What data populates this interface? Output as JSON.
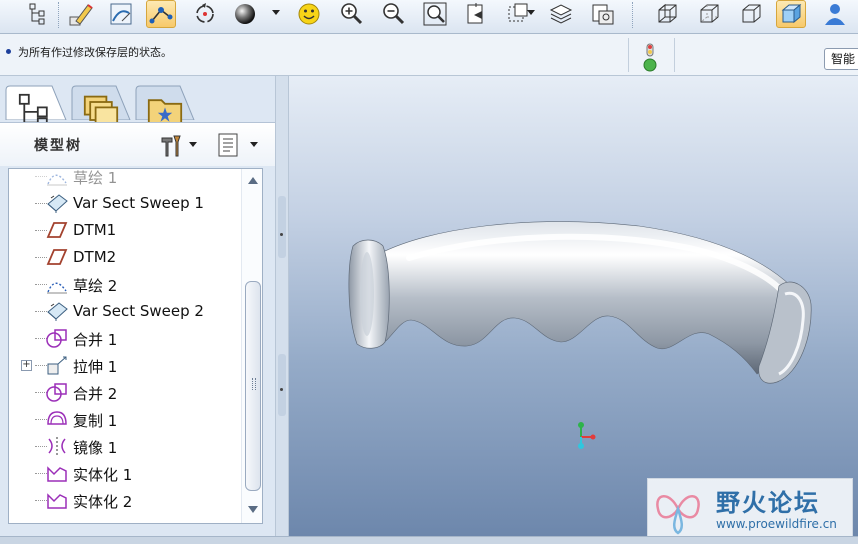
{
  "toolbar": {
    "buttons": [
      {
        "name": "tree-toggle-icon"
      },
      {
        "name": "pencil-icon"
      },
      {
        "name": "sketch-icon"
      },
      {
        "name": "datum-point-icon"
      },
      {
        "name": "spin-icon"
      },
      {
        "name": "shade-sphere-icon"
      },
      {
        "name": "smiley-icon"
      },
      {
        "name": "zoom-in-icon"
      },
      {
        "name": "zoom-out-icon"
      },
      {
        "name": "zoom-fit-icon"
      },
      {
        "name": "reorient-icon"
      },
      {
        "name": "view-manager-icon"
      },
      {
        "name": "layers-icon"
      },
      {
        "name": "saved-views-icon"
      },
      {
        "name": "wireframe-icon"
      },
      {
        "name": "hidden-line-icon"
      },
      {
        "name": "no-hidden-icon"
      },
      {
        "name": "shading-icon"
      },
      {
        "name": "user-icon"
      }
    ]
  },
  "message_bar": {
    "message": "为所有作过修改保存层的状态。",
    "smart_filter_label": "智能"
  },
  "left_panel": {
    "tabs": [
      {
        "name": "model-tree-tab",
        "active": true
      },
      {
        "name": "folder-browser-tab",
        "active": false
      },
      {
        "name": "favorites-tab",
        "active": false
      }
    ],
    "tree_title": "模型树",
    "tree_items": [
      {
        "label": "草绘 1",
        "icon": "sketch-feature-icon",
        "partial": true
      },
      {
        "label": "Var Sect Sweep 1",
        "icon": "var-sect-sweep-icon"
      },
      {
        "label": "DTM1",
        "icon": "datum-plane-icon"
      },
      {
        "label": "DTM2",
        "icon": "datum-plane-icon"
      },
      {
        "label": "草绘 2",
        "icon": "sketch-feature-icon"
      },
      {
        "label": "Var Sect Sweep 2",
        "icon": "var-sect-sweep-icon"
      },
      {
        "label": "合并 1",
        "icon": "merge-icon"
      },
      {
        "label": "拉伸 1",
        "icon": "extrude-icon",
        "expandable": true
      },
      {
        "label": "合并 2",
        "icon": "merge-icon"
      },
      {
        "label": "复制 1",
        "icon": "copy-icon"
      },
      {
        "label": "镜像 1",
        "icon": "mirror-icon"
      },
      {
        "label": "实体化 1",
        "icon": "solidify-icon"
      },
      {
        "label": "实体化 2",
        "icon": "solidify-icon"
      }
    ]
  },
  "watermark": {
    "title": "野火论坛",
    "url": "www.proewildfire.cn"
  },
  "colors": {
    "viewport_top": "#e6edf6",
    "viewport_bottom": "#6d87ac",
    "feature_icon_purple": "#9b2fb8",
    "watermark_blue": "#2f6fa8"
  }
}
